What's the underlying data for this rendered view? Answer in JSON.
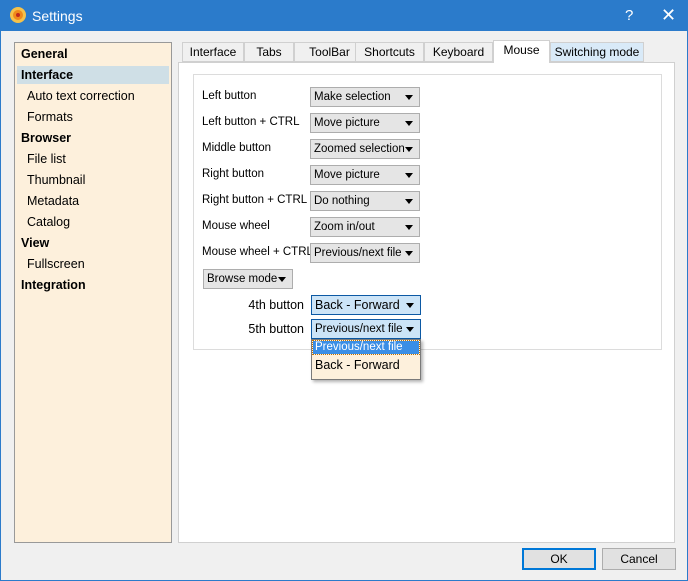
{
  "window": {
    "title": "Settings",
    "help": "?",
    "close": "✕"
  },
  "sidebar": {
    "items": [
      {
        "label": "General",
        "type": "h"
      },
      {
        "label": "Interface",
        "type": "h",
        "selected": true
      },
      {
        "label": "Auto text correction",
        "type": "s"
      },
      {
        "label": "Formats",
        "type": "s"
      },
      {
        "label": "Browser",
        "type": "h"
      },
      {
        "label": "File list",
        "type": "s"
      },
      {
        "label": "Thumbnail",
        "type": "s"
      },
      {
        "label": "Metadata",
        "type": "s"
      },
      {
        "label": "Catalog",
        "type": "s"
      },
      {
        "label": "View",
        "type": "h"
      },
      {
        "label": "Fullscreen",
        "type": "s"
      },
      {
        "label": "Integration",
        "type": "h"
      }
    ]
  },
  "tabs": [
    "Interface",
    "Tabs",
    "ToolBar",
    "Shortcuts",
    "Keyboard",
    "Mouse",
    "Switching mode"
  ],
  "active_tab": "Mouse",
  "mouse": {
    "rows": [
      {
        "label": "Left button",
        "value": "Make selection"
      },
      {
        "label": "Left button + CTRL",
        "value": "Move picture"
      },
      {
        "label": "Middle button",
        "value": "Zoomed selection"
      },
      {
        "label": "Right button",
        "value": "Move picture"
      },
      {
        "label": "Right button + CTRL",
        "value": "Do nothing"
      },
      {
        "label": "Mouse wheel",
        "value": "Zoom in/out"
      },
      {
        "label": "Mouse wheel + CTRL",
        "value": "Previous/next file"
      }
    ],
    "mode": "Browse mode",
    "fourth": {
      "label": "4th button",
      "value": "Back - Forward"
    },
    "fifth": {
      "label": "5th button",
      "value": "Previous/next file"
    },
    "dropdown_options": [
      "Previous/next file",
      "Back - Forward"
    ]
  },
  "buttons": {
    "ok": "OK",
    "cancel": "Cancel"
  }
}
